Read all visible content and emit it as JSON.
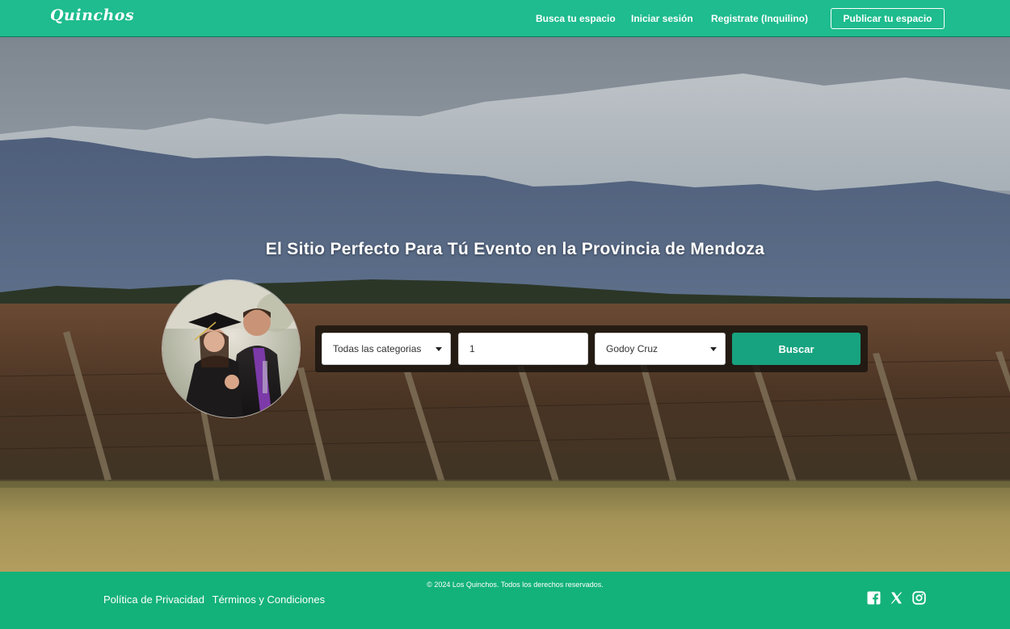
{
  "brand": {
    "logo_text": "Quinchos"
  },
  "nav": {
    "links": [
      "Busca tu espacio",
      "Iniciar sesión",
      "Registrate (Inquilino)"
    ],
    "publish_label": "Publicar tu espacio"
  },
  "hero": {
    "title": "El Sitio Perfecto Para Tú Evento en la Provincia de Mendoza",
    "avatar_alt": "graduation-couple-photo"
  },
  "search": {
    "category": {
      "value": "Todas las categorias",
      "icon": "chevron-down-icon"
    },
    "quantity": {
      "value": "1"
    },
    "location": {
      "value": "Godoy Cruz",
      "icon": "chevron-down-icon"
    },
    "submit_label": "Buscar"
  },
  "footer": {
    "copyright": "© 2024 Los Quinchos. Todos los derechos reservados.",
    "links": [
      "Política de Privacidad",
      "Términos y Condiciones"
    ],
    "socials": [
      "facebook-icon",
      "x-icon",
      "instagram-icon"
    ]
  },
  "colors": {
    "brand": "#1ebc8e",
    "footer": "#13b27a",
    "button": "#17a37f"
  }
}
